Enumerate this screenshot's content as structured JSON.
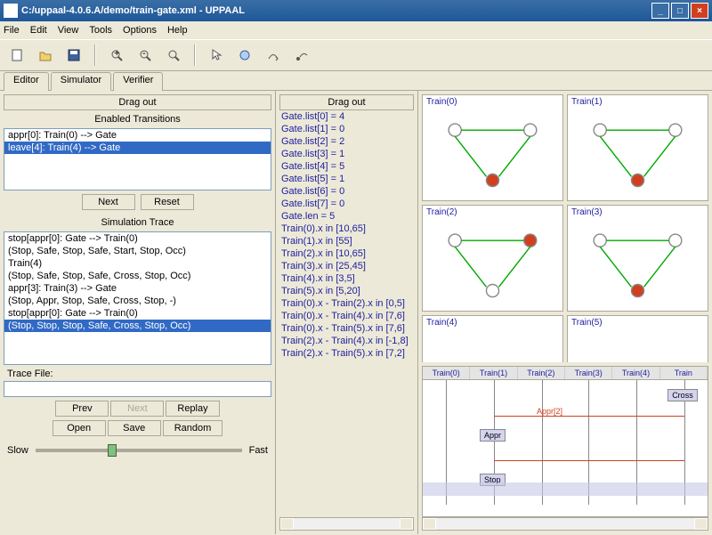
{
  "window": {
    "title": "C:/uppaal-4.0.6.A/demo/train-gate.xml - UPPAAL",
    "min": "_",
    "max": "□",
    "close": "×"
  },
  "menu": {
    "file": "File",
    "edit": "Edit",
    "view": "View",
    "tools": "Tools",
    "options": "Options",
    "help": "Help"
  },
  "tabs": {
    "editor": "Editor",
    "simulator": "Simulator",
    "verifier": "Verifier"
  },
  "panels": {
    "drag_out_l": "Drag out",
    "drag_out_r": "Drag out"
  },
  "sections": {
    "enabled": "Enabled Transitions",
    "trace": "Simulation Trace",
    "tracefile": "Trace File:"
  },
  "transitions": {
    "items": [
      "appr[0]: Train(0) --> Gate",
      "leave[4]: Train(4) --> Gate"
    ]
  },
  "buttons": {
    "next": "Next",
    "reset": "Reset",
    "prev": "Prev",
    "next2": "Next",
    "replay": "Replay",
    "open": "Open",
    "save": "Save",
    "random": "Random"
  },
  "trace": {
    "items": [
      "stop[appr[0]: Gate --> Train(0)",
      "(Stop, Safe, Stop, Safe, Start, Stop, Occ)",
      "Train(4)",
      "(Stop, Safe, Stop, Safe, Cross, Stop, Occ)",
      "appr[3]: Train(3) --> Gate",
      "(Stop, Appr, Stop, Safe, Cross, Stop, -)",
      "stop[appr[0]: Gate --> Train(0)",
      "(Stop, Stop, Stop, Safe, Cross, Stop, Occ)"
    ]
  },
  "slider": {
    "slow": "Slow",
    "fast": "Fast"
  },
  "variables": {
    "items": [
      "Gate.list[0] = 4",
      "Gate.list[1] = 0",
      "Gate.list[2] = 2",
      "Gate.list[3] = 1",
      "Gate.list[4] = 5",
      "Gate.list[5] = 1",
      "Gate.list[6] = 0",
      "Gate.list[7] = 0",
      "Gate.len = 5",
      "Train(0).x in [10,65]",
      "Train(1).x in [55]",
      "Train(2).x in [10,65]",
      "Train(3).x in [25,45]",
      "Train(4).x in [3,5]",
      "Train(5).x in [5,20]",
      "Train(0).x - Train(2).x in [0,5]",
      "Train(0).x - Train(4).x in [7,6]",
      "Train(0).x - Train(5).x in [7,6]",
      "Train(2).x - Train(4).x in [-1,8]",
      "Train(2).x - Train(5).x in [7,2]"
    ]
  },
  "automata": [
    {
      "name": "Train(0)"
    },
    {
      "name": "Train(1)"
    },
    {
      "name": "Train(2)"
    },
    {
      "name": "Train(3)"
    },
    {
      "name": "Train(4)"
    },
    {
      "name": "Train(5)"
    }
  ],
  "msc": {
    "columns": [
      "Train(0)",
      "Train(1)",
      "Train(2)",
      "Train(3)",
      "Train(4)",
      "Train"
    ],
    "boxes": {
      "cross": "Cross",
      "appr": "Appr",
      "stop": "Stop"
    },
    "label": "Appr[2]"
  }
}
